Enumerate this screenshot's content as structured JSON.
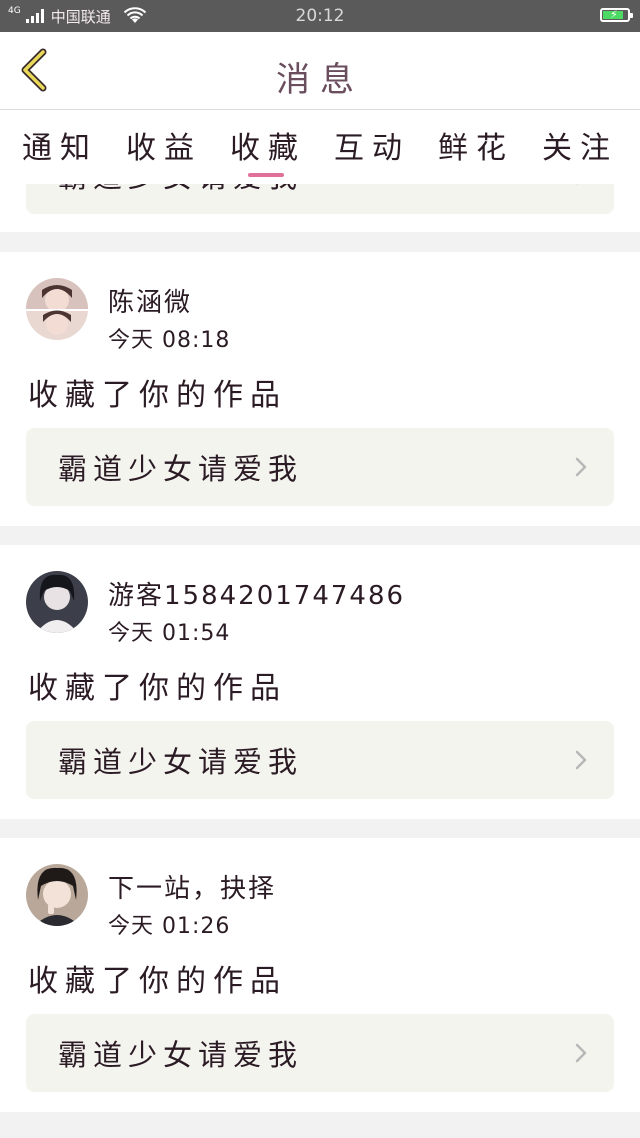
{
  "status_bar": {
    "network_type": "4G",
    "carrier": "中国联通",
    "time": "20:12",
    "battery_level": 0.85,
    "battery_color": "#4cd964"
  },
  "header": {
    "back_icon": "chevron-left-icon",
    "title": "消息"
  },
  "tabs": [
    {
      "label": "通知",
      "active": false
    },
    {
      "label": "收益",
      "active": false
    },
    {
      "label": "收藏",
      "active": true
    },
    {
      "label": "互动",
      "active": false
    },
    {
      "label": "鲜花",
      "active": false
    },
    {
      "label": "关注",
      "active": false
    }
  ],
  "accent_color": "#e0709a",
  "partial_item": {
    "work_title": "霸道少女请爱我"
  },
  "notifications": [
    {
      "user": "陈涵微",
      "time": "今天 08:18",
      "action": "收藏了你的作品",
      "work_title": "霸道少女请爱我"
    },
    {
      "user": "游客1584201747486",
      "time": "今天 01:54",
      "action": "收藏了你的作品",
      "work_title": "霸道少女请爱我"
    },
    {
      "user": "下一站，抉择",
      "time": "今天 01:26",
      "action": "收藏了你的作品",
      "work_title": "霸道少女请爱我"
    }
  ]
}
